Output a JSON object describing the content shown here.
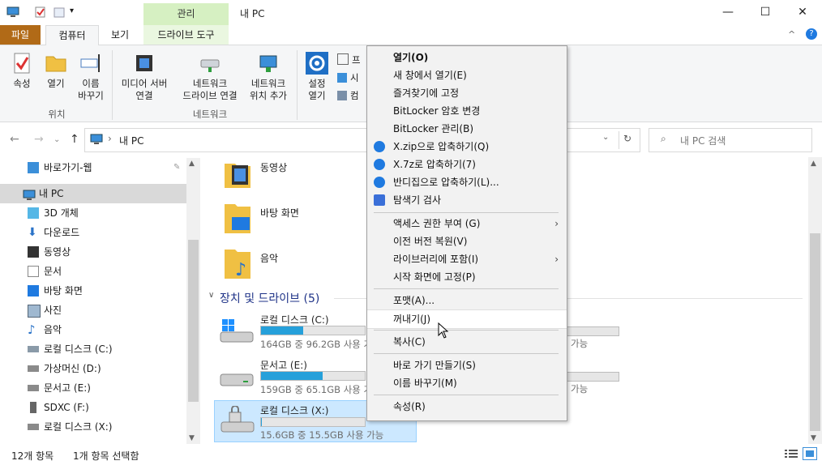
{
  "window": {
    "title": "내 PC",
    "manage_tab": "관리",
    "minimize_glyph": "—",
    "maximize_glyph": "☐",
    "close_glyph": "✕"
  },
  "ribbon_tabs": {
    "file": "파일",
    "computer": "컴퓨터",
    "view": "보기",
    "drive_tools": "드라이브 도구"
  },
  "ribbon": {
    "location_group": "위치",
    "network_group": "네트워크",
    "properties": "속성",
    "open": "열기",
    "rename_line1": "이름",
    "rename_line2": "바꾸기",
    "media_line1": "미디어 서버",
    "media_line2": "연결",
    "netdrive_line1": "네트워크",
    "netdrive_line2": "드라이브 연결",
    "netloc_line1": "네트워크",
    "netloc_line2": "위치 추가",
    "settings_line1": "설정",
    "settings_line2": "열기",
    "small1": "프",
    "small2": "시",
    "small3": "컴"
  },
  "address": {
    "path": "내 PC",
    "search_placeholder": "내 PC 검색"
  },
  "sidebar": {
    "items": [
      {
        "label": "바로가기-웹"
      },
      {
        "label": "내 PC"
      },
      {
        "label": "3D 개체"
      },
      {
        "label": "다운로드"
      },
      {
        "label": "동영상"
      },
      {
        "label": "문서"
      },
      {
        "label": "바탕 화면"
      },
      {
        "label": "사진"
      },
      {
        "label": "음악"
      },
      {
        "label": "로컬 디스크 (C:)"
      },
      {
        "label": "가상머신 (D:)"
      },
      {
        "label": "문서고 (E:)"
      },
      {
        "label": "SDXC (F:)"
      },
      {
        "label": "로컬 디스크 (X:)"
      }
    ]
  },
  "content": {
    "folders": [
      {
        "label": "동영상"
      },
      {
        "label": "바탕 화면"
      },
      {
        "label": "음악"
      }
    ],
    "drives_header": "장치 및 드라이브 (5)",
    "drives": [
      {
        "name": "로컬 디스크 (C:)",
        "usage": "164GB 중 96.2GB 사용 가능",
        "used_fraction": 0.41
      },
      {
        "name": "문서고 (E:)",
        "usage": "159GB 중 65.1GB 사용 가능",
        "used_fraction": 0.59
      },
      {
        "name": "로컬 디스크 (X:)",
        "usage": "15.6GB 중 15.5GB 사용 가능",
        "used_fraction": 0.01
      }
    ],
    "right_col_available_1": "가능",
    "right_col_available_2": "가능"
  },
  "status": {
    "item_count": "12개 항목",
    "selected": "1개 항목 선택함"
  },
  "context_menu": {
    "open": "열기(O)",
    "open_new": "새 창에서 열기(E)",
    "pin_quick": "즐겨찾기에 고정",
    "bitlocker_change": "BitLocker 암호 변경",
    "bitlocker_manage": "BitLocker 관리(B)",
    "zip": "X.zip으로 압축하기(Q)",
    "sevenz": "X.7z로 압축하기(7)",
    "bandizip": "반디집으로 압축하기(L)...",
    "scan": "탐색기 검사",
    "access": "액세스 권한 부여 (G)",
    "restore": "이전 버전 복원(V)",
    "library": "라이브러리에 포함(I)",
    "pin_start": "시작 화면에 고정(P)",
    "format": "포맷(A)...",
    "eject": "꺼내기(J)",
    "copy": "복사(C)",
    "shortcut": "바로 가기 만들기(S)",
    "rename": "이름 바꾸기(M)",
    "properties": "속성(R)"
  }
}
